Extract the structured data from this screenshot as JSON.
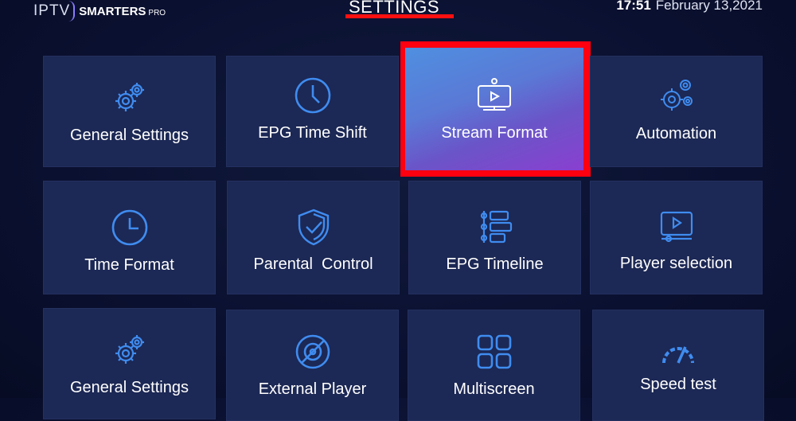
{
  "header": {
    "logo": {
      "iptv": "IPTV",
      "smarters": "SMARTERS",
      "pro": "PRO"
    },
    "title": "SETTINGS",
    "clock": {
      "time": "17:51",
      "date": "February 13,2021"
    }
  },
  "tiles": [
    {
      "label": "General Settings",
      "icon": "gears-icon"
    },
    {
      "label": "EPG Time Shift",
      "icon": "clock-icon"
    },
    {
      "label": "Stream Format",
      "icon": "stream-screen-icon",
      "selected": true
    },
    {
      "label": "Automation",
      "icon": "automation-gears-icon"
    },
    {
      "label": "Time Format",
      "icon": "clock-icon"
    },
    {
      "label": "Parental  Control",
      "icon": "shield-check-icon"
    },
    {
      "label": "EPG Timeline",
      "icon": "timeline-icon"
    },
    {
      "label": "Player selection",
      "icon": "player-screen-icon"
    },
    {
      "label": "General Settings",
      "icon": "gears-icon"
    },
    {
      "label": "External Player",
      "icon": "external-player-icon"
    },
    {
      "label": "Multiscreen",
      "icon": "multiscreen-grid-icon"
    },
    {
      "label": "Speed test",
      "icon": "speedometer-icon"
    }
  ],
  "colors": {
    "tile": "#1c2855",
    "icon": "#3f8cf0",
    "selection_border": "#ff0010",
    "background": "#0a1030"
  }
}
